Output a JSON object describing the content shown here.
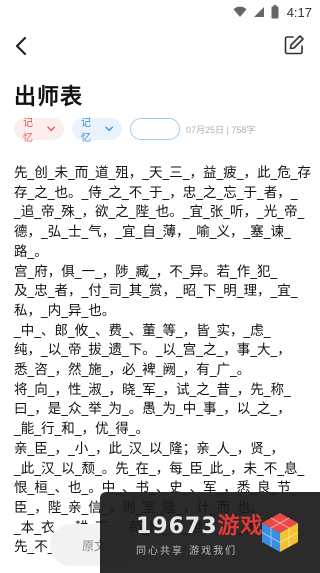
{
  "status_bar": {
    "time": "4:17",
    "icons": [
      "wifi-icon",
      "signal-icon",
      "battery-icon"
    ]
  },
  "top_bar": {
    "back_icon": "chevron-left-icon",
    "edit_icon": "edit-icon"
  },
  "page": {
    "title": "出师表"
  },
  "tags": {
    "tag1_label": "记忆",
    "tag2_label": "记忆",
    "meta": "07月25日 | 758字",
    "colors": {
      "tag1_bg": "#fdeeee",
      "tag1_text": "#e8564f",
      "tag2_bg": "#eaf3fc",
      "tag2_text": "#3c8ad8",
      "empty_border": "#9ccbf2"
    }
  },
  "content": {
    "lines": [
      "先_创_未_而_道_殂，_天_三_，益_疲_，此_危_存",
      "存_之_也。_侍_之_不_于_，忠_之_忘_于_者，_",
      "_追_帝_殊_，欲_之_陛_也。_宜_张_听，_光_帝_",
      "德，_弘_士_气，_宜_自_薄，_喻_义，_塞_谏_",
      "路_。",
      "宫_府，俱_一_，陟_臧_，不_异。若_作_犯_",
      "及_忠_者，_付_司_其_赏，_昭_下_明_理，_宜_",
      "私，_内_异_也。",
      "_中_、郎_攸_、费_、董_等_，皆_实，_虑_",
      "纯，_以_帝_拔_遗_下。_以_宫_之_，事_大_，",
      "悉_咨_，然_施_，必_裨_阙_，有_广_。",
      "将_向_，性_淑_，晓_军_，试_之_昔_，先_称_",
      "曰_，是_众_举_为_。愚_为_中_事_，以_之_，",
      "_能_行_和_，优_得_。",
      "亲_臣_，_小_，此_汉_以_隆；亲_人_，贤_，",
      "_此_汉_以_颓_。先_在_，每_臣_此_，未_不_息_",
      "恨_桓_、也_。中_、书_、史_、军_，悉_良_节_",
      "臣_，陛_亲_信_，则_室_隆_，计_而_也。",
      "_本_衣_，耕_南_，苟_性_于_世，_求_达_诸_。",
      "先_不_臣_鄙_，"
    ]
  },
  "bottom_bar": {
    "button_label": "原文"
  },
  "watermark": {
    "main_prefix": "19673",
    "main_accent": "游戏",
    "sub": "同心共享  游戏我们"
  }
}
